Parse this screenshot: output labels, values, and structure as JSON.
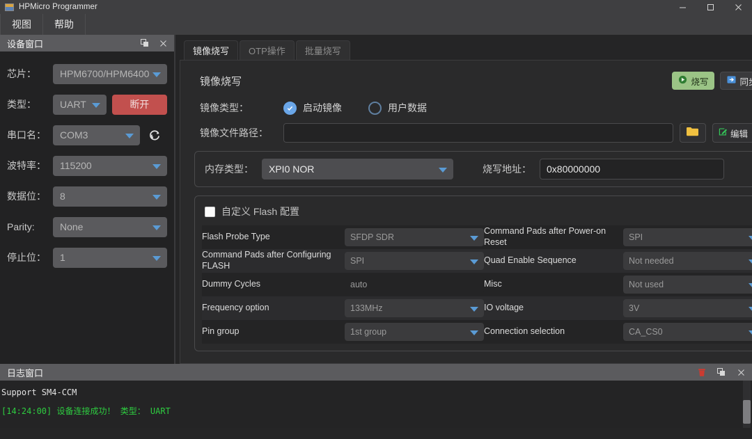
{
  "window": {
    "title": "HPMicro Programmer",
    "icon": "app-icon",
    "minimize": "–",
    "maximize": "□",
    "close": "✕"
  },
  "menubar": {
    "items": [
      {
        "label": "视图"
      },
      {
        "label": "帮助"
      }
    ]
  },
  "device_panel": {
    "title": "设备窗口",
    "float_icon": "float-icon",
    "close_icon": "close-icon",
    "fields": [
      {
        "label": "芯片：",
        "value": "HPM6700/HPM6400",
        "type": "combo"
      },
      {
        "label": "类型：",
        "value": "UART",
        "type": "combo"
      },
      {
        "label": "串口名：",
        "value": "COM3",
        "type": "combo"
      },
      {
        "label": "波特率：",
        "value": "115200",
        "type": "combo"
      },
      {
        "label": "数据位：",
        "value": "8",
        "type": "combo"
      },
      {
        "label": "Parity:",
        "value": "None",
        "type": "combo"
      },
      {
        "label": "停止位：",
        "value": "1",
        "type": "combo"
      }
    ],
    "disconnect_button": "断开",
    "refresh_icon": "refresh-icon"
  },
  "tabs": [
    {
      "label": "镜像烧写",
      "active": true
    },
    {
      "label": "OTP操作",
      "active": false
    },
    {
      "label": "批量烧写",
      "active": false
    }
  ],
  "main": {
    "panel_title": "镜像烧写",
    "burn_button": "烧写",
    "burn_icon": "play-circle-icon",
    "sync_button": "同步到",
    "sync_icon": "arrow-right-box-icon",
    "image_type_label": "镜像类型：",
    "image_type_options": [
      {
        "label": "启动镜像",
        "selected": true
      },
      {
        "label": "用户数据",
        "selected": false
      }
    ],
    "file_path_label": "镜像文件路径：",
    "file_path_value": "",
    "file_path_placeholder": "",
    "browse_icon": "folder-icon",
    "edit_button": "编辑",
    "edit_icon": "pencil-edit-icon",
    "memory_type_label": "内存类型：",
    "memory_type_value": "XPI0 NOR",
    "burn_address_label": "烧写地址：",
    "burn_address_value": "0x80000000",
    "custom_flash_label": "自定义 Flash 配置",
    "custom_flash_checked": false,
    "flash_table": [
      {
        "left_label": "Flash Probe Type",
        "left_value": "SFDP SDR",
        "left_type": "combo",
        "right_label": "Command Pads after Power-on Reset",
        "right_value": "SPI",
        "right_type": "combo"
      },
      {
        "left_label": "Command Pads after Configuring FLASH",
        "left_value": "SPI",
        "left_type": "combo",
        "right_label": "Quad Enable Sequence",
        "right_value": "Not needed",
        "right_type": "combo"
      },
      {
        "left_label": "Dummy Cycles",
        "left_value": "auto",
        "left_type": "text",
        "right_label": "Misc",
        "right_value": "Not used",
        "right_type": "combo"
      },
      {
        "left_label": "Frequency option",
        "left_value": "133MHz",
        "left_type": "combo",
        "right_label": "IO voltage",
        "right_value": "3V",
        "right_type": "combo"
      },
      {
        "left_label": "Pin group",
        "left_value": "1st group",
        "left_type": "combo",
        "right_label": "Connection selection",
        "right_value": "CA_CS0",
        "right_type": "combo"
      }
    ]
  },
  "log_panel": {
    "title": "日志窗口",
    "clear_icon": "trash-icon",
    "float_icon": "float-icon",
    "close_icon": "close-icon",
    "lines": [
      {
        "text": "Support SM4-CCM",
        "color": "white"
      },
      {
        "text": "[14:24:00] 设备连接成功！ 类型： UART",
        "color": "green"
      }
    ]
  },
  "colors": {
    "accent_blue": "#5a9bd5",
    "danger_red": "#c2504e",
    "success_green": "#9bc486",
    "log_green": "#2ecc40",
    "folder_yellow": "#f0c040",
    "panel_bg": "#2a2a2b",
    "titlebar_bg": "#3f3f41"
  }
}
